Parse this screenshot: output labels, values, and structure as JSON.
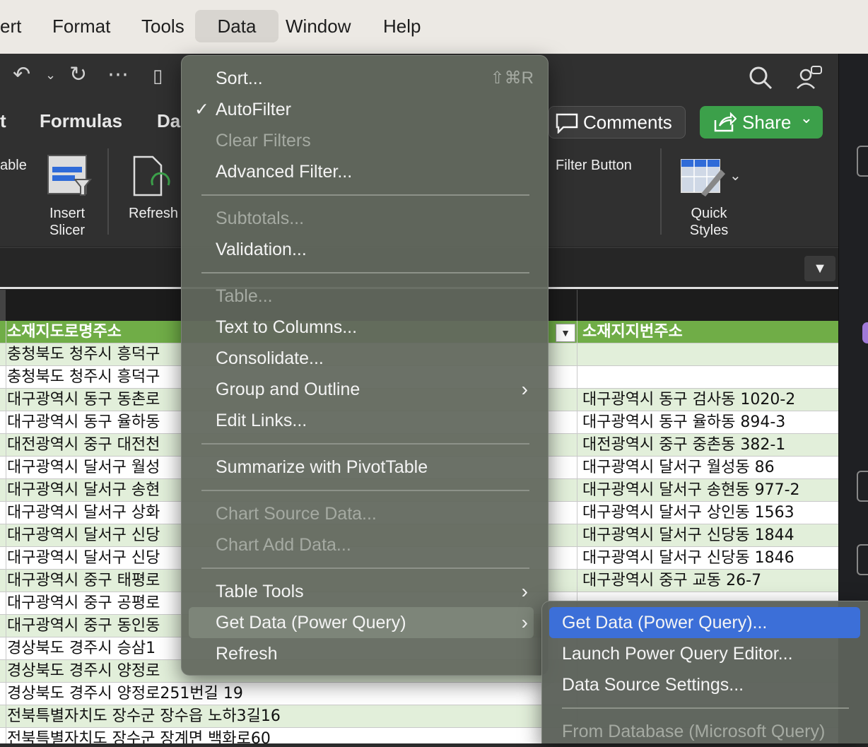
{
  "menubar": {
    "items": [
      "ert",
      "Format",
      "Tools",
      "Data",
      "Window",
      "Help"
    ]
  },
  "ribbon": {
    "tabs": [
      "t",
      "Formulas",
      "Da"
    ],
    "table_label": "able",
    "insert_slicer": "Insert\nSlicer",
    "refresh": "Refresh",
    "filter_button": "Filter Button",
    "quick_styles": "Quick\nStyles",
    "comments": "Comments",
    "share": "Share"
  },
  "data_menu": {
    "items": [
      {
        "label": "Sort...",
        "shortcut": "⇧⌘R",
        "enabled": true
      },
      {
        "label": "AutoFilter",
        "checked": true,
        "enabled": true
      },
      {
        "label": "Clear Filters",
        "enabled": false
      },
      {
        "label": "Advanced Filter...",
        "enabled": true
      },
      {
        "label": "Subtotals...",
        "enabled": false
      },
      {
        "label": "Validation...",
        "enabled": true
      },
      {
        "label": "Table...",
        "enabled": false
      },
      {
        "label": "Text to Columns...",
        "enabled": true
      },
      {
        "label": "Consolidate...",
        "enabled": true
      },
      {
        "label": "Group and Outline",
        "submenu": true,
        "enabled": true
      },
      {
        "label": "Edit Links...",
        "enabled": true
      },
      {
        "label": "Summarize with PivotTable",
        "enabled": true
      },
      {
        "label": "Chart Source Data...",
        "enabled": false
      },
      {
        "label": "Chart Add Data...",
        "enabled": false
      },
      {
        "label": "Table Tools",
        "submenu": true,
        "enabled": true
      },
      {
        "label": "Get Data (Power Query)",
        "submenu": true,
        "highlighted": true,
        "enabled": true
      },
      {
        "label": "Refresh",
        "enabled": true
      }
    ]
  },
  "get_data_submenu": {
    "items": [
      {
        "label": "Get Data (Power Query)...",
        "selected": true
      },
      {
        "label": "Launch Power Query Editor..."
      },
      {
        "label": "Data Source Settings..."
      },
      {
        "label": "From Database (Microsoft Query)",
        "enabled": false
      }
    ]
  },
  "sheet": {
    "header_a": "소재지도로명주소",
    "header_b": "소재지지번주소",
    "rows": [
      {
        "a": "충청북도 청주시 흥덕구",
        "b": ""
      },
      {
        "a": "충청북도 청주시 흥덕구",
        "b": ""
      },
      {
        "a": "대구광역시 동구 동촌로",
        "b": "대구광역시 동구 검사동 1020-2"
      },
      {
        "a": "대구광역시 동구 율하동",
        "b": "대구광역시 동구 율하동 894-3"
      },
      {
        "a": "대전광역시 중구 대전천",
        "b": "대전광역시 중구 중촌동 382-1"
      },
      {
        "a": "대구광역시 달서구 월성",
        "b": "대구광역시 달서구 월성동 86"
      },
      {
        "a": "대구광역시 달서구 송현",
        "b": "대구광역시 달서구 송현동 977-2"
      },
      {
        "a": "대구광역시 달서구 상화",
        "b": "대구광역시 달서구 상인동 1563"
      },
      {
        "a": "대구광역시 달서구 신당",
        "b": "대구광역시 달서구 신당동 1844"
      },
      {
        "a": "대구광역시 달서구 신당",
        "b": "대구광역시 달서구 신당동 1846"
      },
      {
        "a": "대구광역시 중구 태평로",
        "b": "대구광역시 중구 교동 26-7"
      },
      {
        "a": "대구광역시 중구 공평로",
        "b": ""
      },
      {
        "a": "대구광역시 중구 동인동",
        "b": ""
      },
      {
        "a": "경상북도 경주시 승삼1",
        "b": ""
      },
      {
        "a": "경상북도 경주시 양정로",
        "b": ""
      },
      {
        "a": "경상북도 경주시 양정로251번길 19",
        "b": ""
      },
      {
        "a": "전북특별자치도 장수군 장수읍 노하3길16",
        "b": ""
      },
      {
        "a": "전북특별자치도 장수군 장계면 백화로60",
        "b": ""
      }
    ]
  }
}
